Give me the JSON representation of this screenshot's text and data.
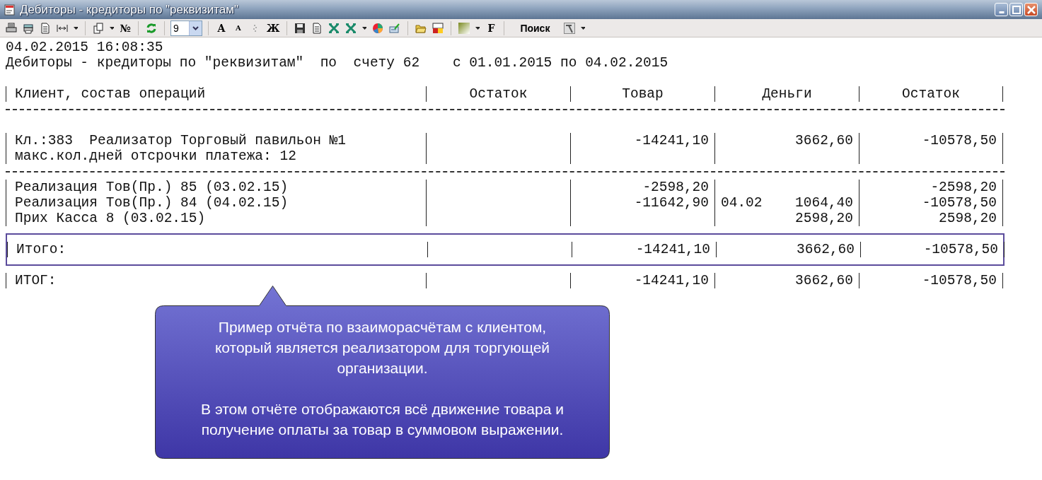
{
  "window": {
    "title": "Дебиторы - кредиторы по \"реквизитам\""
  },
  "toolbar": [
    {
      "kind": "icon"
    },
    {
      "kind": "icon"
    },
    {
      "kind": "icon"
    },
    {
      "kind": "icon"
    },
    {
      "kind": "caret"
    },
    {
      "kind": "sep"
    },
    {
      "kind": "icon"
    },
    {
      "kind": "caret"
    },
    {
      "kind": "text",
      "label": "№"
    },
    {
      "kind": "sep"
    },
    {
      "kind": "icon"
    },
    {
      "kind": "sep"
    },
    {
      "kind": "select",
      "value": "9"
    },
    {
      "kind": "sep"
    },
    {
      "kind": "text",
      "label": "A"
    },
    {
      "kind": "small-text",
      "label": "A"
    },
    {
      "kind": "icon"
    },
    {
      "kind": "text",
      "label": "Ж"
    },
    {
      "kind": "sep"
    },
    {
      "kind": "icon"
    },
    {
      "kind": "icon"
    },
    {
      "kind": "icon"
    },
    {
      "kind": "icon"
    },
    {
      "kind": "caret"
    },
    {
      "kind": "icon"
    },
    {
      "kind": "icon"
    },
    {
      "kind": "sep"
    },
    {
      "kind": "icon"
    },
    {
      "kind": "icon"
    },
    {
      "kind": "sep"
    },
    {
      "kind": "icon"
    },
    {
      "kind": "caret"
    },
    {
      "kind": "text",
      "label": "F"
    },
    {
      "kind": "sep"
    },
    {
      "kind": "label",
      "label": "Поиск"
    },
    {
      "kind": "icon"
    },
    {
      "kind": "caret"
    }
  ],
  "report": {
    "timestamp": "04.02.2015 16:08:35",
    "title": "Дебиторы - кредиторы по \"реквизитам\"  по  счету 62    с 01.01.2015 по 04.02.2015",
    "columns": [
      "Клиент, состав операций",
      "Остаток",
      "Товар",
      "Деньги",
      "Остаток"
    ],
    "rows": [
      {
        "kind": "separator"
      },
      {
        "kind": "blank"
      },
      {
        "kind": "client",
        "cells": [
          "Кл.:383  Реализатор Торговый павильон №1",
          "",
          "-14241,10",
          "3662,60",
          "-10578,50"
        ]
      },
      {
        "kind": "client",
        "cells": [
          "макс.кол.дней отсрочки платежа: 12",
          "",
          "",
          "",
          ""
        ]
      },
      {
        "kind": "separator"
      },
      {
        "kind": "operation",
        "cells": [
          "Реализация Тов(Пр.) 85 (03.02.15)",
          "",
          "-2598,20",
          "",
          "-2598,20"
        ]
      },
      {
        "kind": "operation",
        "cells": [
          "Реализация Тов(Пр.) 84 (04.02.15)",
          "",
          "-11642,90",
          {
            "date": "04.02",
            "amount": "1064,40"
          },
          "-10578,50"
        ]
      },
      {
        "kind": "operation",
        "cells": [
          "Прих Касса 8 (03.02.15)",
          "",
          "",
          "2598,20",
          "2598,20"
        ]
      },
      {
        "kind": "blank"
      },
      {
        "kind": "total",
        "highlighted": true,
        "cells": [
          "Итого:",
          "",
          "-14241,10",
          "3662,60",
          "-10578,50"
        ]
      },
      {
        "kind": "blank"
      },
      {
        "kind": "total",
        "highlighted": false,
        "cells": [
          "ИТОГ:",
          "",
          "-14241,10",
          "3662,60",
          "-10578,50"
        ]
      }
    ]
  },
  "callout": {
    "paragraphs": [
      "Пример отчёта по взаиморасчётам с клиентом, который является реализатором для торгующей организации.",
      "В этом отчёте отображаются всё движение товара и получение оплаты за товар в суммовом выражении."
    ]
  }
}
